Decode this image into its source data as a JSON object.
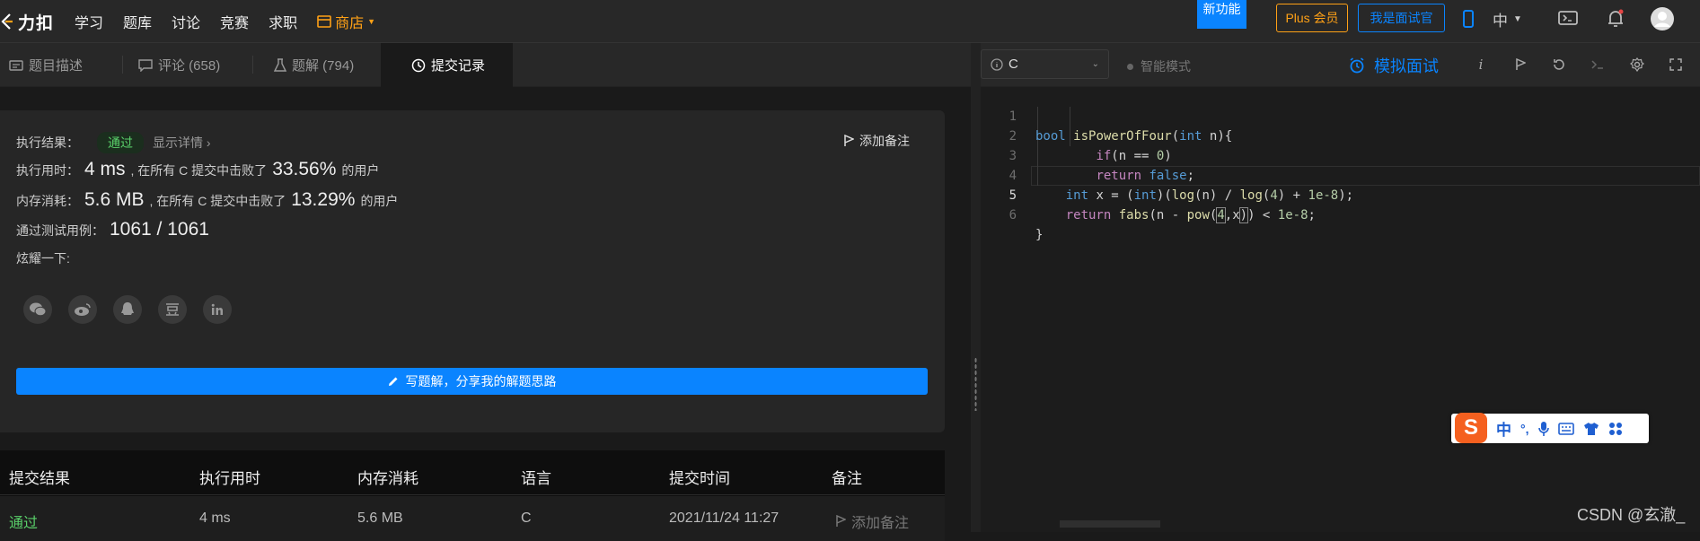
{
  "header": {
    "logo_text": "力扣",
    "nav": [
      "学习",
      "题库",
      "讨论",
      "竞赛",
      "求职"
    ],
    "shop_label": "商店",
    "new_feature": "新功能",
    "plus_label": "Plus 会员",
    "interviewer_label": "我是面试官",
    "lang_label": "中"
  },
  "tabs": [
    {
      "label": "题目描述",
      "icon": "description-icon"
    },
    {
      "label": "评论 (658)",
      "icon": "comment-icon"
    },
    {
      "label": "题解 (794)",
      "icon": "flask-icon"
    },
    {
      "label": "提交记录",
      "icon": "clock-icon"
    }
  ],
  "result": {
    "status_label": "执行结果：",
    "status": "通过",
    "details_link": "显示详情",
    "add_note": "添加备注",
    "runtime_label": "执行用时：",
    "runtime": "4 ms",
    "runtime_mid": ", 在所有 C 提交中击败了",
    "runtime_pct": "33.56%",
    "runtime_tail": "的用户",
    "memory_label": "内存消耗：",
    "memory": "5.6 MB",
    "memory_mid": ", 在所有 C 提交中击败了",
    "memory_pct": "13.29%",
    "memory_tail": "的用户",
    "tests_label": "通过测试用例：",
    "tests": "1061 / 1061",
    "share_label": "炫耀一下:",
    "share_icons": [
      "wechat-icon",
      "weibo-icon",
      "qq-icon",
      "douban-icon",
      "linkedin-icon"
    ],
    "write_button": "写题解，分享我的解题思路"
  },
  "table": {
    "headers": [
      "提交结果",
      "执行用时",
      "内存消耗",
      "语言",
      "提交时间",
      "备注"
    ],
    "rows": [
      {
        "result": "通过",
        "runtime": "4 ms",
        "memory": "5.6 MB",
        "language": "C",
        "time": "2021/11/24 11:27",
        "note": "添加备注"
      }
    ]
  },
  "editor": {
    "language": "C",
    "smart_mode": "智能模式",
    "mock_interview": "模拟面试",
    "line_numbers": [
      "1",
      "2",
      "3",
      "4",
      "5",
      "6"
    ]
  },
  "ime": {
    "logo": "S",
    "items": [
      "中",
      "°,",
      "mic-icon",
      "keyboard-icon",
      "shirt-icon",
      "grid-icon"
    ]
  },
  "watermark": "CSDN @玄澈_"
}
